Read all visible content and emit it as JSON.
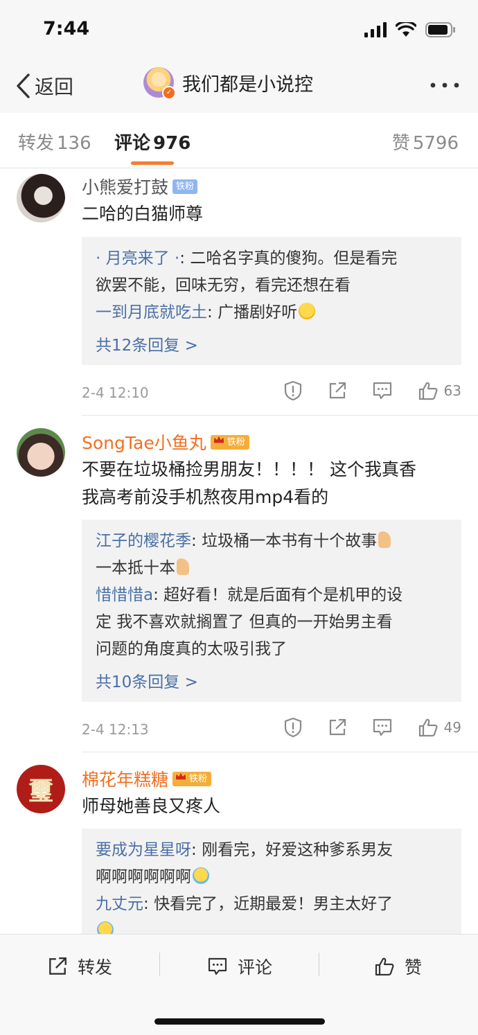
{
  "status_bar": {
    "time": "7:44"
  },
  "nav": {
    "back_label": "返回",
    "title": "我们都是小说控"
  },
  "tabs": {
    "forward": {
      "label": "转发",
      "count": "136"
    },
    "comment": {
      "label": "评论",
      "count": "976"
    },
    "like": {
      "label": "赞",
      "count": "5796"
    }
  },
  "comments": [
    {
      "author": "小熊爱打鼓",
      "badge": "铁粉",
      "text_lines": [
        "二哈的白猫师尊"
      ],
      "replies": [
        {
          "who": "· 月亮来了 ·",
          "sep": ": ",
          "lines": [
            "二哈名字真的傻狗。但是看完",
            "欲罢不能，回味无穷，看完还想在看"
          ]
        },
        {
          "who": "一到月底就吃土",
          "sep": ": ",
          "lines": [
            "广播剧好听"
          ]
        }
      ],
      "total_replies": "共12条回复 >",
      "time": "2-4 12:10",
      "likes": "63"
    },
    {
      "author": "SongTae小鱼丸",
      "badge": "铁粉",
      "text_lines": [
        "不要在垃圾桶捡男朋友！！！！ 这个我真香",
        "我高考前没手机熬夜用mp4看的"
      ],
      "replies": [
        {
          "who": "江子的樱花季",
          "sep": ": ",
          "lines": [
            "垃圾桶一本书有十个故事",
            "一本抵十本"
          ]
        },
        {
          "who": "惜惜惜a",
          "sep": ": ",
          "lines": [
            "超好看！就是后面有个是机甲的设",
            "定 我不喜欢就搁置了 但真的一开始男主看",
            "问题的角度真的太吸引我了"
          ]
        }
      ],
      "total_replies": "共10条回复 >",
      "time": "2-4 12:13",
      "likes": "49"
    },
    {
      "author": "棉花年糕糖",
      "badge": "铁粉",
      "avatar_text": "璽",
      "text_lines": [
        "师母她善良又疼人"
      ],
      "replies": [
        {
          "who": "要成为星星呀",
          "sep": ": ",
          "lines": [
            "刚看完，好爱这种爹系男友",
            "啊啊啊啊啊啊"
          ]
        },
        {
          "who": "九丈元",
          "sep": ": ",
          "lines": [
            "快看完了，近期最爱！男主太好了"
          ]
        }
      ]
    }
  ],
  "bottom_bar": {
    "forward": "转发",
    "comment": "评论",
    "like": "赞"
  },
  "colors": {
    "accent": "#f57c33",
    "link": "#4a6fa5",
    "vip_name": "#f26f21"
  }
}
